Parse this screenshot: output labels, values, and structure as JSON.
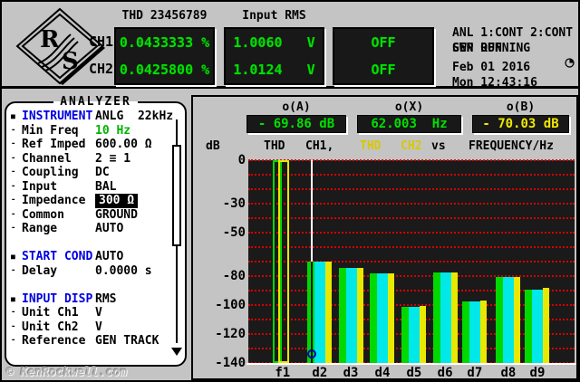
{
  "top_bar": {
    "logo_name": "rohde-schwarz-logo",
    "channel_labels": [
      "CH1",
      "CH2"
    ],
    "displays": [
      {
        "title": "THD 23456789",
        "lines": [
          "0.0433333 %",
          "0.0425800 %"
        ]
      },
      {
        "title": "Input RMS",
        "lines": [
          "1.0060   V",
          "1.0124   V"
        ]
      },
      {
        "title": "",
        "lines": [
          "OFF",
          "OFF"
        ]
      }
    ],
    "status": {
      "gen": "GEN RUNNING",
      "anl": "ANL 1:CONT 2:CONT",
      "swp": "SWP OFF",
      "date": "Feb 01 2016",
      "time": "Mon 12:43:16"
    }
  },
  "analyzer_panel": {
    "title": "ANALYZER",
    "rows": [
      {
        "type": "header",
        "marker": "■",
        "label": "INSTRUMENT",
        "value": "ANLG  22kHz",
        "value_style": "normal"
      },
      {
        "type": "item",
        "marker": "-",
        "label": "Min Freq",
        "value": "10 Hz",
        "value_style": "green"
      },
      {
        "type": "item",
        "marker": "-",
        "label": "Ref Imped",
        "value": "600.00 Ω",
        "value_style": "normal"
      },
      {
        "type": "item",
        "marker": "-",
        "label": "Channel",
        "value": "2 ≡ 1",
        "value_style": "normal"
      },
      {
        "type": "item",
        "marker": "-",
        "label": "Coupling",
        "value": "DC",
        "value_style": "normal"
      },
      {
        "type": "item",
        "marker": "-",
        "label": "Input",
        "value": "BAL",
        "value_style": "normal"
      },
      {
        "type": "item",
        "marker": "-",
        "label": "Impedance",
        "value": "300 Ω",
        "value_style": "highlight"
      },
      {
        "type": "item",
        "marker": "-",
        "label": "Common",
        "value": "GROUND",
        "value_style": "normal"
      },
      {
        "type": "item",
        "marker": "-",
        "label": "Range",
        "value": "AUTO",
        "value_style": "normal"
      },
      {
        "type": "spacer"
      },
      {
        "type": "header",
        "marker": "■",
        "label": "START COND",
        "value": "AUTO",
        "value_style": "normal"
      },
      {
        "type": "item",
        "marker": "-",
        "label": "Delay",
        "value": "0.0000 s",
        "value_style": "normal"
      },
      {
        "type": "spacer"
      },
      {
        "type": "header",
        "marker": "■",
        "label": "INPUT DISP",
        "value": "RMS",
        "value_style": "normal"
      },
      {
        "type": "item",
        "marker": "-",
        "label": "Unit Ch1",
        "value": "V",
        "value_style": "normal"
      },
      {
        "type": "item",
        "marker": "-",
        "label": "Unit Ch2",
        "value": "V",
        "value_style": "normal"
      },
      {
        "type": "item",
        "marker": "-",
        "label": "Reference",
        "value": "GEN TRACK",
        "value_style": "normal"
      }
    ]
  },
  "watermark": "© KenRockwell.com",
  "chart": {
    "readouts": [
      {
        "label": "o(A)",
        "value": "- 69.86 dB",
        "color": "green"
      },
      {
        "label": "o(X)",
        "value": "62.003  Hz",
        "color": "green"
      },
      {
        "label": "o(B)",
        "value": "- 70.03 dB",
        "color": "yellow"
      }
    ],
    "unit_label": "dB",
    "title_tokens": [
      {
        "text": "THD",
        "color": "black",
        "x": 78
      },
      {
        "text": "CH1,",
        "color": "black",
        "x": 124
      },
      {
        "text": "THD",
        "color": "yellow",
        "x": 184
      },
      {
        "text": "CH2",
        "color": "yellow",
        "x": 229
      },
      {
        "text": "vs",
        "color": "black",
        "x": 263
      },
      {
        "text": "FREQUENCY/Hz",
        "color": "black",
        "x": 304
      }
    ]
  },
  "chart_data": {
    "type": "bar",
    "title": "THD CH1, THD CH2 vs FREQUENCY/Hz",
    "ylabel": "dB",
    "xlabel": "FREQUENCY/Hz",
    "ylim": [
      -140,
      0
    ],
    "grid_step_db": 10,
    "grid_color": "#dd0000",
    "ytick_labels": [
      0,
      -30,
      -50,
      -80,
      -100,
      -120,
      -140
    ],
    "categories": [
      "f1",
      "d2",
      "d3",
      "d4",
      "d5",
      "d6",
      "d7",
      "d8",
      "d9"
    ],
    "series": [
      {
        "name": "THD CH1",
        "color": "#00d800",
        "values": [
          0,
          -69.86,
          -74.2,
          -78.0,
          -101.0,
          -77.4,
          -97.4,
          -80.8,
          -89.5
        ]
      },
      {
        "name": "THD CH2",
        "color": "#e8e800",
        "values": [
          0,
          -70.03,
          -74.4,
          -78.2,
          -100.6,
          -77.8,
          -96.8,
          -80.4,
          -88.4
        ]
      }
    ],
    "fundamental_outline_only": true,
    "bar_centers_pct": [
      10.5,
      21.9,
      31.4,
      41.1,
      50.8,
      60.3,
      69.4,
      79.7,
      88.6
    ],
    "cursor": {
      "category": "d2",
      "x_pct": 19.2,
      "marker_db": -134,
      "a_readout": "- 69.86 dB",
      "x_readout": "62.003  Hz",
      "b_readout": "- 70.03 dB"
    }
  }
}
